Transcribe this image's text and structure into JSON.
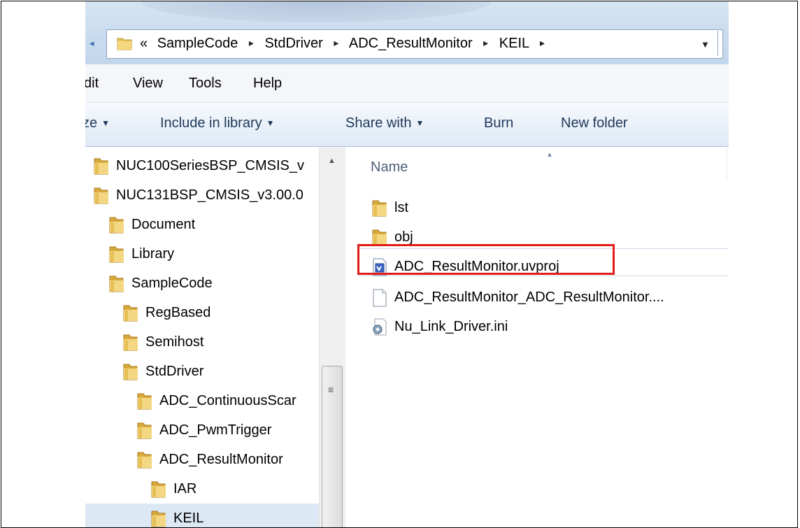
{
  "address_bar": {
    "back_arrow": "◂",
    "overflow": "«",
    "crumbs": [
      "SampleCode",
      "StdDriver",
      "ADC_ResultMonitor",
      "KEIL"
    ],
    "separator": "▸",
    "dropdown": "▼",
    "folder_icon": "folder-icon"
  },
  "menu": [
    "Edit",
    "View",
    "Tools",
    "Help"
  ],
  "menu_visible": [
    "dit",
    "View",
    "Tools",
    "Help"
  ],
  "toolbar": {
    "organize_partial": "ze",
    "include_in_library": "Include in library",
    "share_with": "Share with",
    "burn": "Burn",
    "new_folder": "New folder",
    "caret": "▼"
  },
  "nav_pane": {
    "items": [
      {
        "label": "NUC100SeriesBSP_CMSIS_v",
        "icon": "folder-icon"
      },
      {
        "label": "NUC131BSP_CMSIS_v3.00.0",
        "icon": "folder-icon"
      },
      {
        "label": "Document",
        "icon": "folder-icon"
      },
      {
        "label": "Library",
        "icon": "folder-icon"
      },
      {
        "label": "SampleCode",
        "icon": "folder-icon"
      },
      {
        "label": "RegBased",
        "icon": "folder-icon"
      },
      {
        "label": "Semihost",
        "icon": "folder-icon"
      },
      {
        "label": "StdDriver",
        "icon": "folder-icon"
      },
      {
        "label": "ADC_ContinuousScar",
        "icon": "folder-icon"
      },
      {
        "label": "ADC_PwmTrigger",
        "icon": "folder-icon"
      },
      {
        "label": "ADC_ResultMonitor",
        "icon": "folder-icon"
      },
      {
        "label": "IAR",
        "icon": "folder-icon"
      },
      {
        "label": "KEIL",
        "icon": "folder-icon",
        "selected": true
      }
    ],
    "scroll_up": "▲",
    "scroll_grip": "≡"
  },
  "file_list": {
    "column_name": "Name",
    "sort_indicator": "▲",
    "files": [
      {
        "label": "lst",
        "icon": "folder-icon"
      },
      {
        "label": "obj",
        "icon": "folder-icon"
      },
      {
        "label": "ADC_ResultMonitor.uvproj",
        "icon": "uvproj-file-icon",
        "highlighted": true
      },
      {
        "label": "ADC_ResultMonitor_ADC_ResultMonitor....",
        "icon": "blank-file-icon"
      },
      {
        "label": "Nu_Link_Driver.ini",
        "icon": "settings-file-icon"
      }
    ]
  },
  "colors": {
    "highlight_box": "#e21b1b",
    "folder": "#e8c25a",
    "address_bg": "#c9dbee",
    "toolbar_text": "#1e395b"
  }
}
